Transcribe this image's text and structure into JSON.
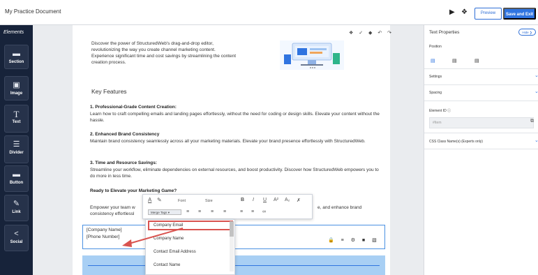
{
  "window": {
    "title": "My Practice Document"
  },
  "topbar": {
    "preview_label": "Preview",
    "save_label": "Save and Exit"
  },
  "sidebar": {
    "title": "Elements",
    "items": [
      {
        "label": "Section",
        "icon": "section-icon"
      },
      {
        "label": "Image",
        "icon": "image-icon"
      },
      {
        "label": "Text",
        "icon": "text-icon"
      },
      {
        "label": "Divider",
        "icon": "divider-icon"
      },
      {
        "label": "Button",
        "icon": "button-icon"
      },
      {
        "label": "Link",
        "icon": "link-icon"
      },
      {
        "label": "Social",
        "icon": "social-icon"
      }
    ]
  },
  "content": {
    "intro_line1": "Discover the power of StructuredWeb's drag-and-drop editor,",
    "intro_line2": "revolutionizing the way you create channel marketing content.",
    "intro_line3": "Experience significant time and cost savings by streamlining the content",
    "intro_line4": "creation process.",
    "key_features": "Key Features",
    "f1_title": "1. Professional-Grade Content Creation:",
    "f1_body": "Learn how to craft compelling emails and landing pages effortlessly, without the need for coding or design skills. Elevate your content without the hassle.",
    "f2_title": "2. Enhanced Brand Consistency",
    "f2_body": "Maintain brand consistency seamlessly across all your marketing materials. Elevate your brand presence effortlessly with StructuredWeb.",
    "f3_title": "3. Time and Resource Savings:",
    "f3_body": "Streamline your workflow, eliminate dependencies on external resources, and boost productivity. Discover how StructuredWeb empowers you to do more in less time.",
    "ready": "Ready to Elevate your Marketing Game?",
    "empower_left1": "Empower your team w",
    "empower_left2": "consistency effortlessl",
    "empower_right": "e, and enhance brand",
    "company_name": "[Company Name]",
    "phone_number": "[Phone Number]"
  },
  "toolbar": {
    "font_label": "Font",
    "size_label": "Size",
    "merge_tags_label": "Merge Tags"
  },
  "dropdown": {
    "items": [
      "Company Email",
      "Company Name",
      "Contact Email Address",
      "Contact Name"
    ],
    "highlighted": "Company Email"
  },
  "right_panel": {
    "title": "Text Properties",
    "hide_label": "Hide",
    "position_label": "Position",
    "settings_label": "Settings",
    "spacing_label": "Spacing",
    "element_id_label": "Element ID",
    "element_id_placeholder": "#Item",
    "css_class_label": "CSS Class Name(s) (Experts only)"
  },
  "colors": {
    "accent": "#2f74e0",
    "sidebar": "#17233a",
    "highlight": "#d9534f",
    "band": "#a8cff4"
  }
}
